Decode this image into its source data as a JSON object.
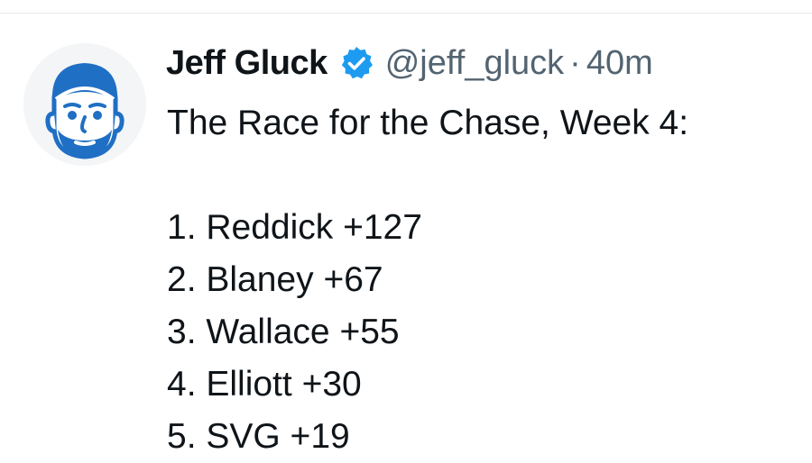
{
  "tweet": {
    "display_name": "Jeff Gluck",
    "handle": "@jeff_gluck",
    "separator": "·",
    "timestamp": "40m",
    "intro": "The Race for the Chase, Week 4:",
    "list": [
      "1. Reddick +127",
      "2. Blaney +67",
      "3. Wallace +55",
      "4. Elliott +30",
      "5. SVG +19"
    ]
  },
  "colors": {
    "text": "#0f1419",
    "secondary": "#536471",
    "verified": "#1d9bf0",
    "avatar_blue": "#1f6fc4"
  },
  "icons": {
    "avatar": "cartoon-face-with-cap",
    "verified": "verified-check-badge"
  }
}
